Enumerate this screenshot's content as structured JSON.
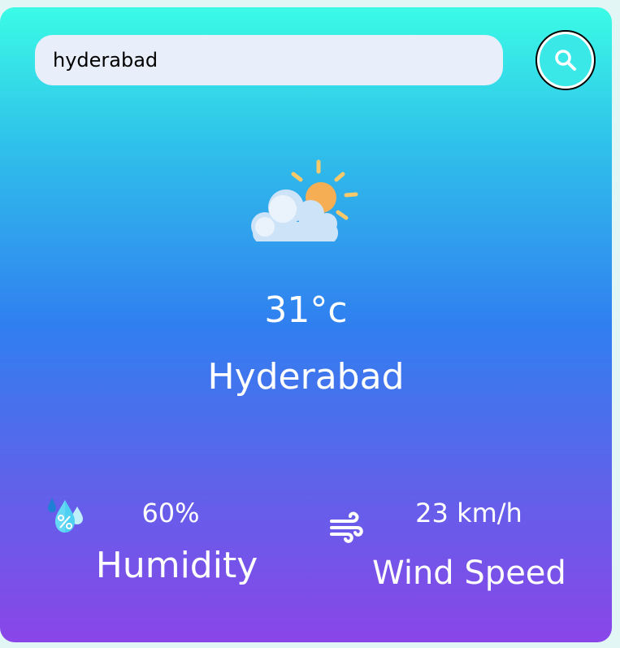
{
  "search": {
    "value": "hyderabad",
    "button_icon": "search-icon"
  },
  "weather": {
    "icon": "partly-cloudy-icon",
    "temperature": "31°c",
    "city": "Hyderabad"
  },
  "details": {
    "humidity": {
      "icon": "humidity-icon",
      "value": "60%",
      "label": "Humidity"
    },
    "wind": {
      "icon": "wind-icon",
      "value": "23 km/h",
      "label": "Wind Speed"
    }
  },
  "colors": {
    "gradient_top": "#3bfbe6",
    "gradient_mid": "#307ff0",
    "gradient_bottom": "#8a45e8",
    "search_bg": "#e8eefa",
    "button_bg": "#3ae8e8",
    "text": "#ffffff"
  }
}
